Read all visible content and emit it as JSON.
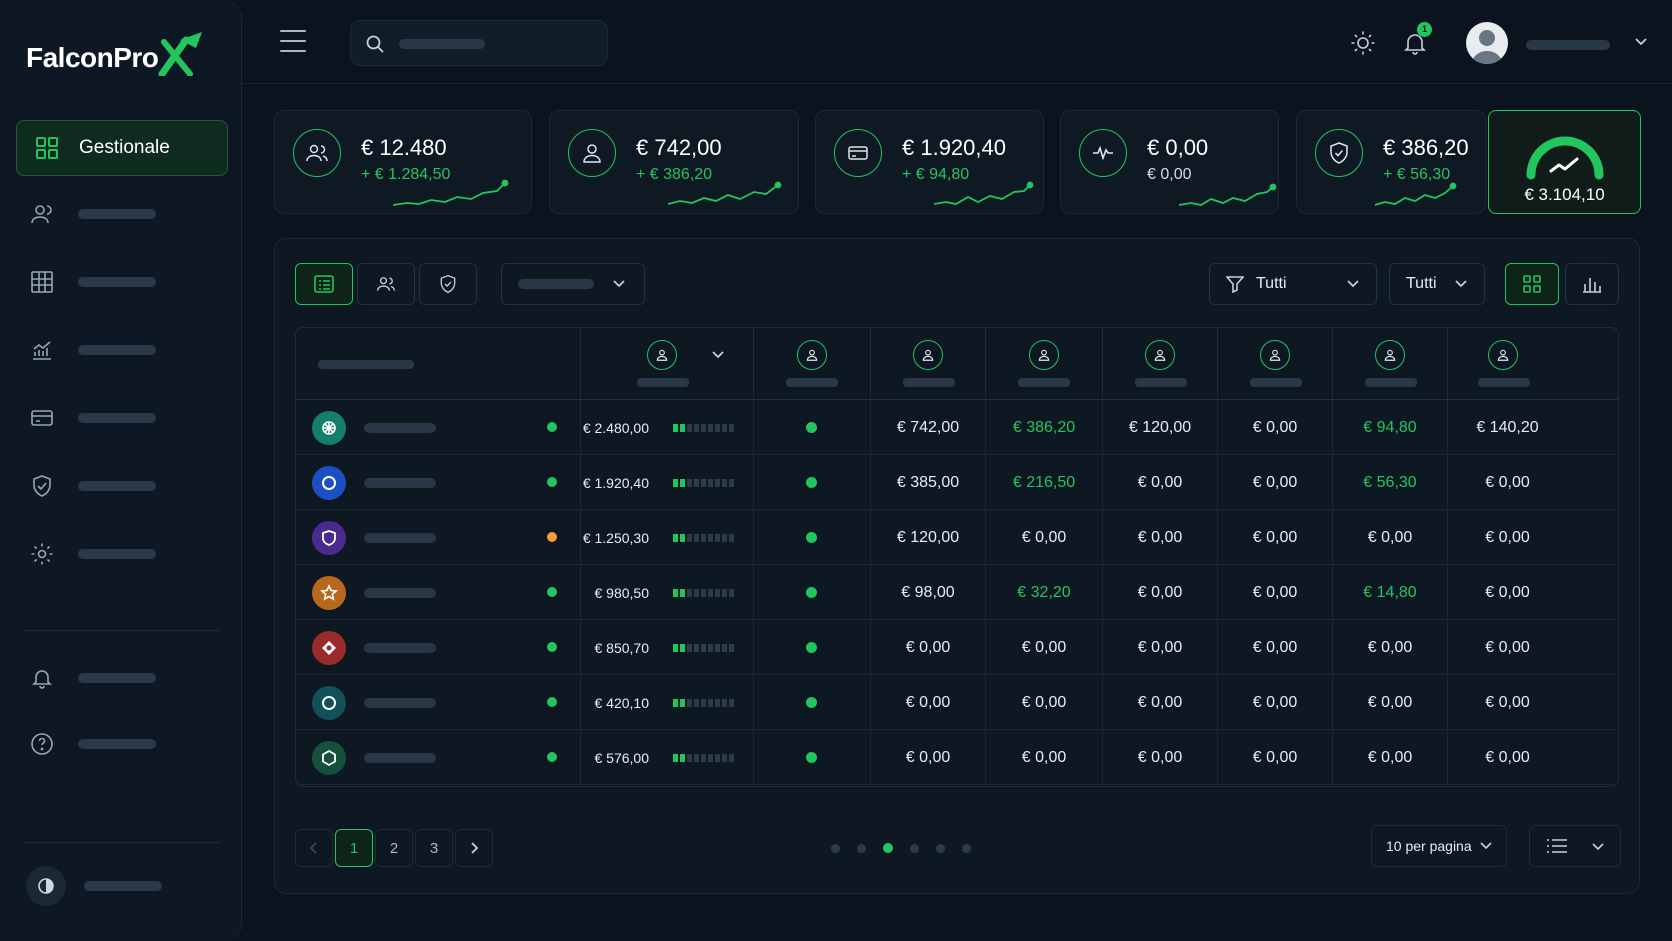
{
  "brand": {
    "name": "FalconPro",
    "accent": "#22c55e"
  },
  "sidebar": {
    "active_label": "Gestionale",
    "items": [
      {
        "icon": "users-icon"
      },
      {
        "icon": "grid-table-icon"
      },
      {
        "icon": "chart-line-icon"
      },
      {
        "icon": "card-icon"
      },
      {
        "icon": "shield-check-icon"
      },
      {
        "icon": "gear-icon"
      }
    ],
    "bottom": [
      {
        "icon": "bell-icon"
      },
      {
        "icon": "help-icon"
      }
    ]
  },
  "topbar": {
    "notif_count": "1"
  },
  "kpis": [
    {
      "icon": "users-icon",
      "value": "€ 12.480",
      "sub": "+ € 1.284,50"
    },
    {
      "icon": "user-icon",
      "value": "€ 742,00",
      "sub": "+ € 386,20"
    },
    {
      "icon": "card-icon",
      "value": "€ 1.920,40",
      "sub": "+ € 94,80"
    },
    {
      "icon": "pulse-icon",
      "value": "€ 0,00",
      "sub": "€ 0,00"
    },
    {
      "icon": "shield-check-icon",
      "value": "€ 386,20",
      "sub": "+ € 56,30"
    }
  ],
  "gauge_kpi": {
    "value": "€ 3.104,10"
  },
  "filters": {
    "type_filter": "Tutti",
    "second_filter": "Tutti"
  },
  "table": {
    "rows": [
      {
        "avatar_color": "#14806a",
        "status": "green",
        "amount": "€ 2.480,00",
        "bar": 2,
        "status2": "green",
        "c1": "€ 742,00",
        "c2": "€ 386,20",
        "c2g": true,
        "c3": "€ 120,00",
        "c4": "€ 0,00",
        "c5": "€ 94,80",
        "c5g": true,
        "c6": "€ 140,20"
      },
      {
        "avatar_color": "#1d4fc4",
        "status": "green",
        "amount": "€ 1.920,40",
        "bar": 2,
        "status2": "green",
        "c1": "€ 385,00",
        "c2": "€ 216,50",
        "c2g": true,
        "c3": "€ 0,00",
        "c4": "€ 0,00",
        "c5": "€ 56,30",
        "c5g": true,
        "c6": "€ 0,00"
      },
      {
        "avatar_color": "#4b2a8f",
        "status": "orange",
        "amount": "€ 1.250,30",
        "bar": 2,
        "status2": "green",
        "c1": "€ 120,00",
        "c2": "€ 0,00",
        "c2g": false,
        "c3": "€ 0,00",
        "c4": "€ 0,00",
        "c5": "€ 0,00",
        "c5g": false,
        "c6": "€ 0,00"
      },
      {
        "avatar_color": "#b8681d",
        "status": "green",
        "amount": "€ 980,50",
        "bar": 2,
        "status2": "green",
        "c1": "€ 98,00",
        "c2": "€ 32,20",
        "c2g": true,
        "c3": "€ 0,00",
        "c4": "€ 0,00",
        "c5": "€ 14,80",
        "c5g": true,
        "c6": "€ 0,00"
      },
      {
        "avatar_color": "#9b2a2a",
        "status": "green",
        "amount": "€ 850,70",
        "bar": 2,
        "status2": "green",
        "c1": "€ 0,00",
        "c2": "€ 0,00",
        "c2g": false,
        "c3": "€ 0,00",
        "c4": "€ 0,00",
        "c5": "€ 0,00",
        "c5g": false,
        "c6": "€ 0,00"
      },
      {
        "avatar_color": "#12505a",
        "status": "green",
        "amount": "€ 420,10",
        "bar": 2,
        "status2": "green",
        "c1": "€ 0,00",
        "c2": "€ 0,00",
        "c2g": false,
        "c3": "€ 0,00",
        "c4": "€ 0,00",
        "c5": "€ 0,00",
        "c5g": false,
        "c6": "€ 0,00"
      },
      {
        "avatar_color": "#14503a",
        "status": "green",
        "amount": "€ 576,00",
        "bar": 2,
        "status2": "green",
        "c1": "€ 0,00",
        "c2": "€ 0,00",
        "c2g": false,
        "c3": "€ 0,00",
        "c4": "€ 0,00",
        "c5": "€ 0,00",
        "c5g": false,
        "c6": "€ 0,00"
      }
    ]
  },
  "pagination": {
    "pages": [
      "1",
      "2",
      "3"
    ],
    "current": "1",
    "per_page": "10 per pagina",
    "dots_active": 2,
    "dots_count": 6
  }
}
